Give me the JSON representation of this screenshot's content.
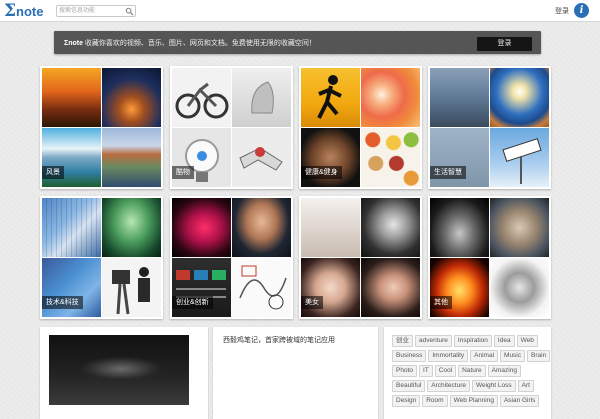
{
  "header": {
    "logo_sigma": "Σ",
    "logo_text": "note",
    "search_placeholder": "搜索信息功能",
    "login_label": "登录",
    "info_icon_glyph": "i",
    "accent_color": "#2a6fb6"
  },
  "banner": {
    "brand": "Σnote",
    "text": " 收藏你喜欢的视频、音乐、图片、网页和文档。免费使用无限的收藏空间！",
    "button_label": "登录"
  },
  "categories": [
    {
      "label": "风景",
      "tiles": [
        "sunset-landscape",
        "coastal-town-night",
        "mountain-lake",
        "lakeside-forest"
      ]
    },
    {
      "label": "酷物",
      "tiles": [
        "concept-bicycle",
        "futuristic-chair",
        "robot-sphere",
        "robotic-arm"
      ]
    },
    {
      "label": "健康&健身",
      "tiles": [
        "runner-silhouette",
        "grapefruit",
        "muscular-man",
        "vegetables-grid"
      ]
    },
    {
      "label": "生活智慧",
      "tiles": [
        "quote-poster",
        "desert-jump",
        "quote-text",
        "better-life-sign"
      ]
    },
    {
      "label": "技术&科技",
      "tiles": [
        "app-icons",
        "green-head",
        "social-icons",
        "cameraman-robot"
      ]
    },
    {
      "label": "创业&创新",
      "tiles": [
        "red-fiber-art",
        "young-entrepreneur",
        "behavior-types-slide",
        "sketch-diagram"
      ]
    },
    {
      "label": "美女",
      "tiles": [
        "woman-white-dress",
        "woman-bw-portrait",
        "woman-face-closeup",
        "woman-dark-hair"
      ]
    },
    {
      "label": "其他",
      "tiles": [
        "woman-silhouette-bw",
        "kitten",
        "fire-horse",
        "splash-horse"
      ]
    }
  ],
  "bottom": {
    "headline": "西毅鸡笔记，首家跨被域的笔记应用",
    "tags": [
      "创业",
      "adventure",
      "Inspiration",
      "Idea",
      "Web",
      "Business",
      "Immortality",
      "Animal",
      "Music",
      "Brain",
      "Photo",
      "IT",
      "Cool",
      "Nature",
      "Amazing",
      "Beautiful",
      "Architecture",
      "Weight Loss",
      "Art",
      "Design",
      "Room",
      "Web Planning",
      "Asian Girls"
    ]
  }
}
